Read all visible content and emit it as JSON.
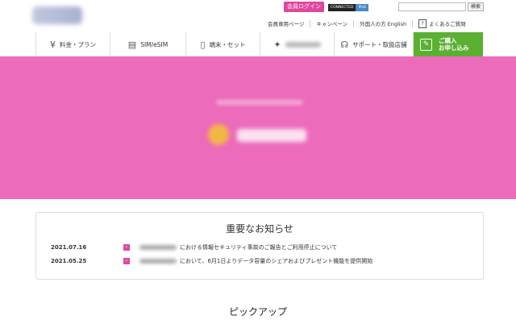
{
  "header": {
    "login_label": "会員ログイン",
    "badge": {
      "connected": "CONNECTED",
      "ipv6": "IPv6"
    },
    "search_placeholder": "",
    "search_button": "検索",
    "util_links": [
      "会員専用ページ",
      "キャンペーン",
      "外国人の方 English"
    ],
    "faq_label": "よくあるご質問",
    "faq_icon_text": "?"
  },
  "nav": {
    "items": [
      {
        "icon": "yen-icon",
        "glyph": "¥",
        "label": "料金・プラン"
      },
      {
        "icon": "sim-card-icon",
        "glyph": "▤",
        "label": "SIM/eSIM"
      },
      {
        "icon": "device-icon",
        "glyph": "▯",
        "label": "端末・セット"
      },
      {
        "icon": "sparkle-icon",
        "glyph": "✦",
        "label": ""
      },
      {
        "icon": "headset-icon",
        "glyph": "☊",
        "label": "サポート・取扱店舗"
      }
    ],
    "apply_line1": "ご購入",
    "apply_line2": "お申し込み",
    "apply_icon": "✎"
  },
  "colors": {
    "hero": "#ec6bba",
    "accent": "#e0479e",
    "apply": "#5ab031"
  },
  "notice": {
    "title": "重要なお知らせ",
    "items": [
      {
        "date": "2021.07.16",
        "text": "における情報セキュリティ事故のご報告とご利用停止について"
      },
      {
        "date": "2021.05.25",
        "text": "において、6月1日よりデータ容量のシェアおよびプレゼント機能を提供開始"
      }
    ]
  },
  "pickup_title": "ピックアップ"
}
